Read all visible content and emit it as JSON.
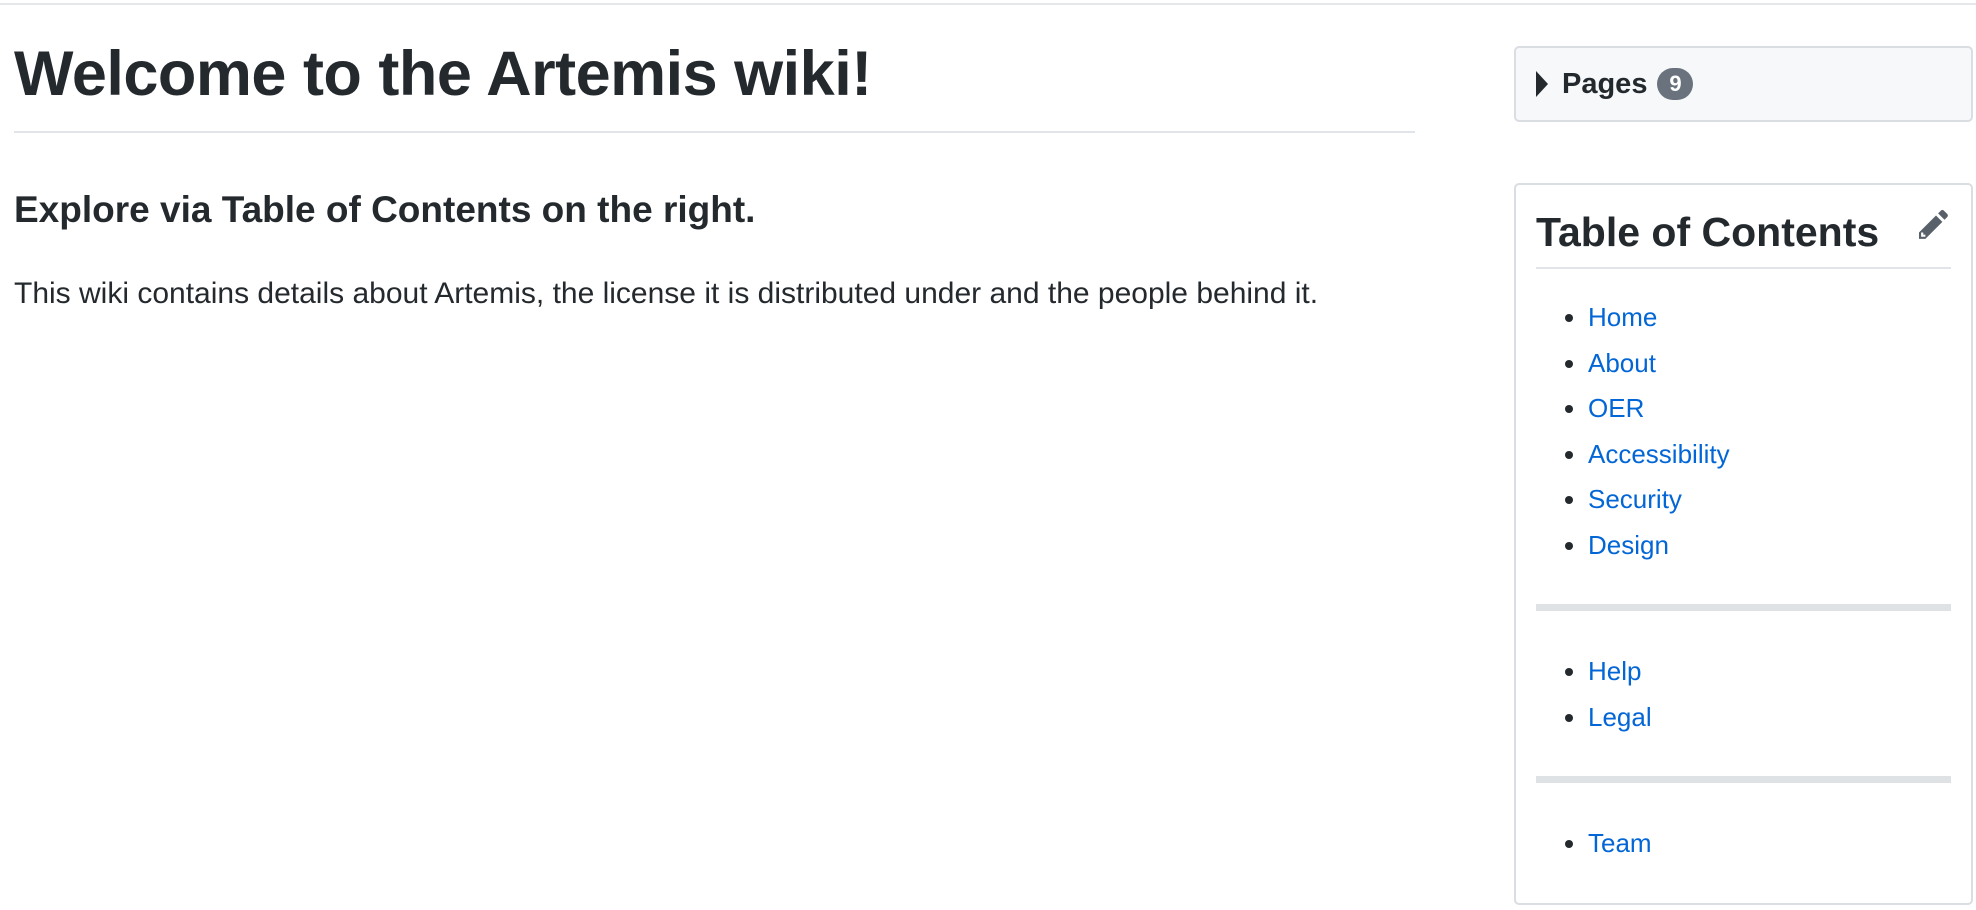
{
  "main": {
    "title": "Welcome to the Artemis wiki!",
    "subheading": "Explore via Table of Contents on the right.",
    "body": "This wiki contains details about Artemis, the license it is distributed under and the people behind it."
  },
  "sidebar": {
    "pages": {
      "label": "Pages",
      "count": "9",
      "icon": "triangle-right-icon"
    },
    "toc": {
      "title": "Table of Contents",
      "edit_icon": "pencil-icon",
      "groups": [
        [
          "Home",
          "About",
          "OER",
          "Accessibility",
          "Security",
          "Design"
        ],
        [
          "Help",
          "Legal"
        ],
        [
          "Team"
        ]
      ]
    }
  },
  "colors": {
    "link": "#0366d6",
    "text": "#24292e",
    "badge": "#6a737d",
    "border": "#dadde1"
  }
}
